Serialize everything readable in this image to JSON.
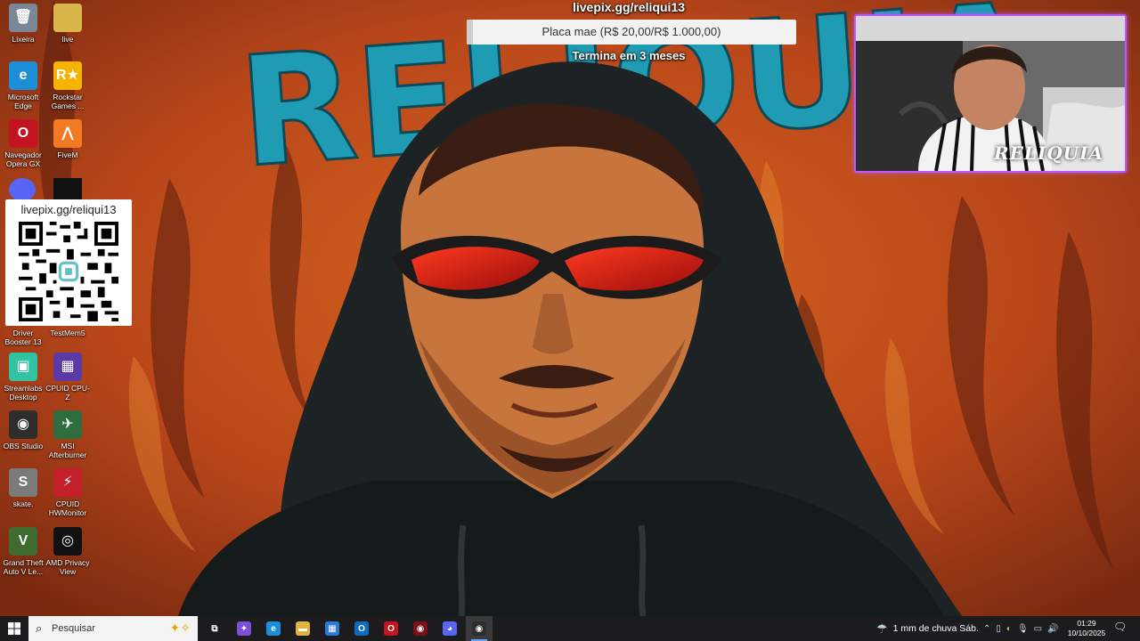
{
  "desktop": {
    "icons": [
      {
        "label": "Lixeira",
        "icon": "recycle-bin-icon",
        "color": "#7a8895",
        "glyph": "🗑"
      },
      {
        "label": "live",
        "icon": "folder-icon",
        "color": "#d9b54a",
        "glyph": ""
      },
      {
        "label": "Microsoft Edge",
        "icon": "edge-icon",
        "color": "#1d8fd8",
        "glyph": "e"
      },
      {
        "label": "Rockstar Games ...",
        "icon": "rockstar-icon",
        "color": "#f4b400",
        "glyph": "R★"
      },
      {
        "label": "Navegador Opera GX",
        "icon": "opera-gx-icon",
        "color": "#c3141f",
        "glyph": "O"
      },
      {
        "label": "FiveM",
        "icon": "fivem-icon",
        "color": "#f17b23",
        "glyph": "⋀"
      },
      {
        "label": "Driver Booster 13",
        "icon": "driver-booster-icon",
        "color": "#d13b2a",
        "glyph": ""
      },
      {
        "label": "TestMem5",
        "icon": "testmem-icon",
        "color": "#444",
        "glyph": ""
      },
      {
        "label": "Streamlabs Desktop",
        "icon": "streamlabs-icon",
        "color": "#31c3a2",
        "glyph": "▣"
      },
      {
        "label": "CPUID CPU-Z",
        "icon": "cpuz-icon",
        "color": "#5b3aa6",
        "glyph": "▦"
      },
      {
        "label": "OBS Studio",
        "icon": "obs-icon",
        "color": "#2d2d2d",
        "glyph": "◉"
      },
      {
        "label": "MSI Afterburner",
        "icon": "afterburner-icon",
        "color": "#2f6d3c",
        "glyph": "✈"
      },
      {
        "label": "skate.",
        "icon": "skate-icon",
        "color": "#7a7a7a",
        "glyph": "S"
      },
      {
        "label": "CPUID HWMonitor",
        "icon": "hwmonitor-icon",
        "color": "#c4202a",
        "glyph": "⚡"
      },
      {
        "label": "Grand Theft Auto V Le...",
        "icon": "gta-v-icon",
        "color": "#3e6b2e",
        "glyph": "V"
      },
      {
        "label": "AMD Privacy View",
        "icon": "amd-privacy-icon",
        "color": "#111",
        "glyph": "◎"
      }
    ],
    "discord_icon": "discord-icon",
    "app_icon_partial": "app-icon"
  },
  "qr": {
    "url": "livepix.gg/reliqui13"
  },
  "goal": {
    "title": "livepix.gg/reliqui13",
    "text": "Placa mae (R$ 20,00/R$ 1.000,00)",
    "progress": 0.02,
    "ends": "Termina em 3 meses"
  },
  "webcam": {
    "label": "RELIQUIA",
    "border_color": "#b65cff"
  },
  "wallpaper": {
    "title": "RELIQUIA",
    "title_color": "#1f9cb4"
  },
  "taskbar": {
    "search_placeholder": "Pesquisar",
    "apps": [
      {
        "name": "taskview",
        "icon": "task-view-icon",
        "glyph": "⧉",
        "color": "#1c1c1e"
      },
      {
        "name": "copilot",
        "icon": "copilot-icon",
        "glyph": "✦",
        "color": "#7b4fd6"
      },
      {
        "name": "edge",
        "icon": "edge-icon",
        "glyph": "e",
        "color": "#1d8fd8"
      },
      {
        "name": "explorer",
        "icon": "file-explorer-icon",
        "glyph": "▬",
        "color": "#e3b341"
      },
      {
        "name": "store",
        "icon": "store-icon",
        "glyph": "▦",
        "color": "#2b7ad6"
      },
      {
        "name": "outlook",
        "icon": "outlook-icon",
        "glyph": "O",
        "color": "#0f6cbd"
      },
      {
        "name": "opera",
        "icon": "opera-gx-icon",
        "glyph": "O",
        "color": "#c3141f"
      },
      {
        "name": "unknown-red",
        "icon": "app-icon",
        "glyph": "◉",
        "color": "#7a1018"
      },
      {
        "name": "discord",
        "icon": "discord-icon",
        "glyph": "◕",
        "color": "#5865f2"
      },
      {
        "name": "obs",
        "icon": "obs-icon",
        "glyph": "◉",
        "color": "#2d2d2d"
      }
    ],
    "weather_text": "1 mm de chuva Sáb.",
    "time": "01:29",
    "date": "10/10/2025"
  }
}
